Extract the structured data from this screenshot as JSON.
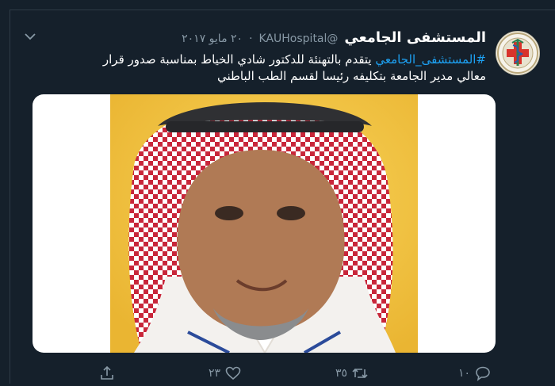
{
  "tweet": {
    "display_name": "المستشفى الجامعي",
    "handle": "@KAUHospital",
    "separator": "·",
    "date": "٢٠ مايو ٢٠١٧",
    "text_hashtag": "#المستشفى_الجامعي",
    "text_line1_rest": " يتقدم بالتهنئة للدكتور شادي الخياط بمناسبة صدور قرار",
    "text_line2": "معالي مدير الجامعة بتكليفه رئيسا لقسم الطب الباطني"
  },
  "actions": {
    "reply_count": "١٠",
    "retweet_count": "٣٥",
    "like_count": "٢٣"
  },
  "icons": {
    "reply": "speech-bubble-icon",
    "retweet": "retweet-icon",
    "like": "heart-icon",
    "share": "share-icon",
    "more": "chevron-down-icon"
  },
  "colors": {
    "background": "#15202b",
    "text": "#ffffff",
    "secondary": "#8899a6",
    "link": "#1da1f2",
    "photo_background": "#f5c542"
  }
}
